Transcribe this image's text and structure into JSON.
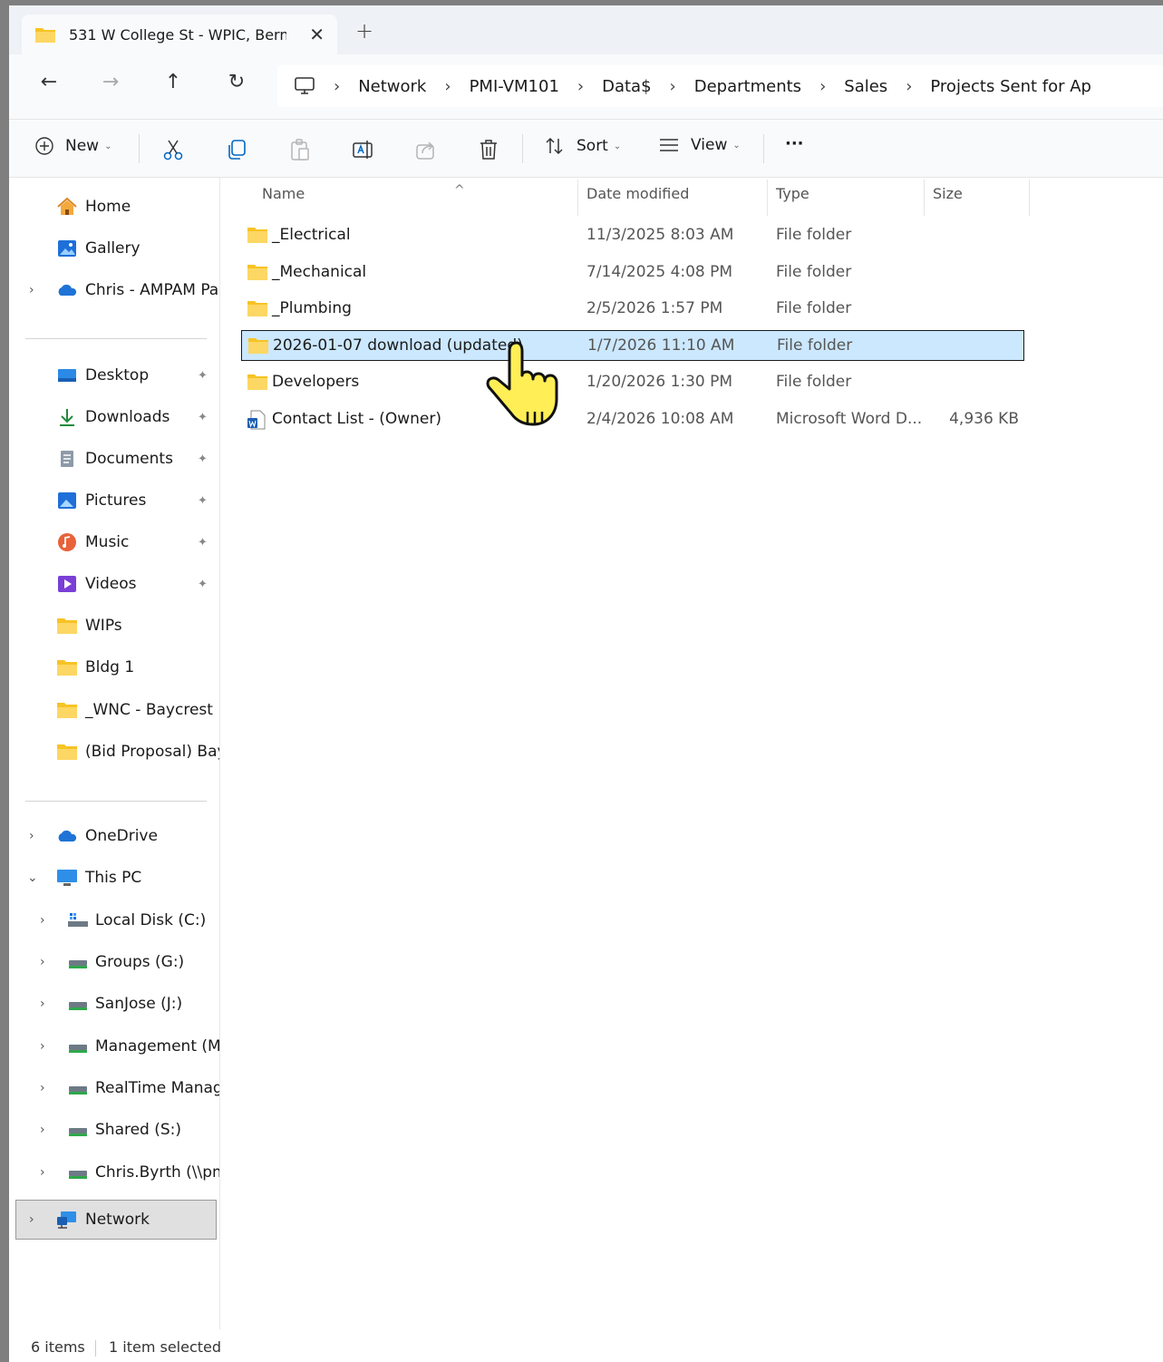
{
  "window": {
    "tab_title": "531 W College St - WPIC, Bern",
    "tab_close": "✕",
    "new_tab": "+"
  },
  "nav": {
    "back": "←",
    "forward": "→",
    "up": "↑",
    "refresh": "↻"
  },
  "breadcrumb": [
    "Network",
    "PMI-VM101",
    "Data$",
    "Departments",
    "Sales",
    "Projects Sent for Ap"
  ],
  "breadcrumb_sep": "›",
  "toolbar": {
    "new_label": "New",
    "sort_label": "Sort",
    "view_label": "View",
    "more_label": "···",
    "chev": "⌄"
  },
  "sidebar": {
    "quick": [
      {
        "label": "Home",
        "icon": "home-icon"
      },
      {
        "label": "Gallery",
        "icon": "gallery-icon"
      },
      {
        "label": "Chris - AMPAM Par",
        "icon": "onedrive-cloud-icon",
        "expandable": true
      }
    ],
    "pinned": [
      {
        "label": "Desktop",
        "icon": "desktop-icon",
        "pinned": true
      },
      {
        "label": "Downloads",
        "icon": "download-icon",
        "pinned": true
      },
      {
        "label": "Documents",
        "icon": "documents-icon",
        "pinned": true
      },
      {
        "label": "Pictures",
        "icon": "pictures-icon",
        "pinned": true
      },
      {
        "label": "Music",
        "icon": "music-icon",
        "pinned": true
      },
      {
        "label": "Videos",
        "icon": "videos-icon",
        "pinned": true
      },
      {
        "label": "WIPs",
        "icon": "folder-icon"
      },
      {
        "label": "Bldg 1",
        "icon": "folder-icon"
      },
      {
        "label": "_WNC - Baycrest Bl",
        "icon": "folder-icon"
      },
      {
        "label": "(Bid Proposal) Bayc",
        "icon": "folder-icon"
      }
    ],
    "tree": [
      {
        "label": "OneDrive",
        "icon": "onedrive-cloud-icon",
        "level": 0,
        "expand": "›"
      },
      {
        "label": "This PC",
        "icon": "this-pc-icon",
        "level": 0,
        "expand": "⌄"
      },
      {
        "label": "Local Disk (C:)",
        "icon": "local-disk-icon",
        "level": 1,
        "expand": "›"
      },
      {
        "label": "Groups (G:)",
        "icon": "network-drive-icon",
        "level": 1,
        "expand": "›"
      },
      {
        "label": "SanJose (J:)",
        "icon": "network-drive-icon",
        "level": 1,
        "expand": "›"
      },
      {
        "label": "Management (M:",
        "icon": "network-drive-icon",
        "level": 1,
        "expand": "›"
      },
      {
        "label": "RealTime Manage",
        "icon": "network-drive-icon",
        "level": 1,
        "expand": "›"
      },
      {
        "label": "Shared (S:)",
        "icon": "network-drive-icon",
        "level": 1,
        "expand": "›"
      },
      {
        "label": "Chris.Byrth (\\\\pm",
        "icon": "network-drive-icon",
        "level": 1,
        "expand": "›"
      },
      {
        "label": "Network",
        "icon": "network-icon",
        "level": 0,
        "expand": "›",
        "selected": true
      }
    ],
    "pin_glyph": "📌"
  },
  "columns": {
    "name": "Name",
    "date": "Date modified",
    "type": "Type",
    "size": "Size",
    "sort_indicator": "^"
  },
  "files": [
    {
      "name": "_Electrical",
      "date": "11/3/2025 8:03 AM",
      "type": "File folder",
      "size": "",
      "icon": "folder-icon"
    },
    {
      "name": "_Mechanical",
      "date": "7/14/2025 4:08 PM",
      "type": "File folder",
      "size": "",
      "icon": "folder-icon"
    },
    {
      "name": "_Plumbing",
      "date": "2/5/2026 1:57 PM",
      "type": "File folder",
      "size": "",
      "icon": "folder-icon"
    },
    {
      "name": "2026-01-07 download (updated)",
      "date": "1/7/2026 11:10 AM",
      "type": "File folder",
      "size": "",
      "icon": "folder-icon",
      "selected": true
    },
    {
      "name": "Developers",
      "date": "1/20/2026 1:30 PM",
      "type": "File folder",
      "size": "",
      "icon": "folder-icon"
    },
    {
      "name": "Contact List - (Owner)",
      "date": "2/4/2026 10:08 AM",
      "type": "Microsoft Word D...",
      "size": "4,936 KB",
      "icon": "word-document-icon"
    }
  ],
  "status": {
    "count": "6 items",
    "selection": "1 item selected"
  },
  "colors": {
    "folder": "#f7c325",
    "selection": "#cce8ff",
    "accent": "#0067c0"
  }
}
